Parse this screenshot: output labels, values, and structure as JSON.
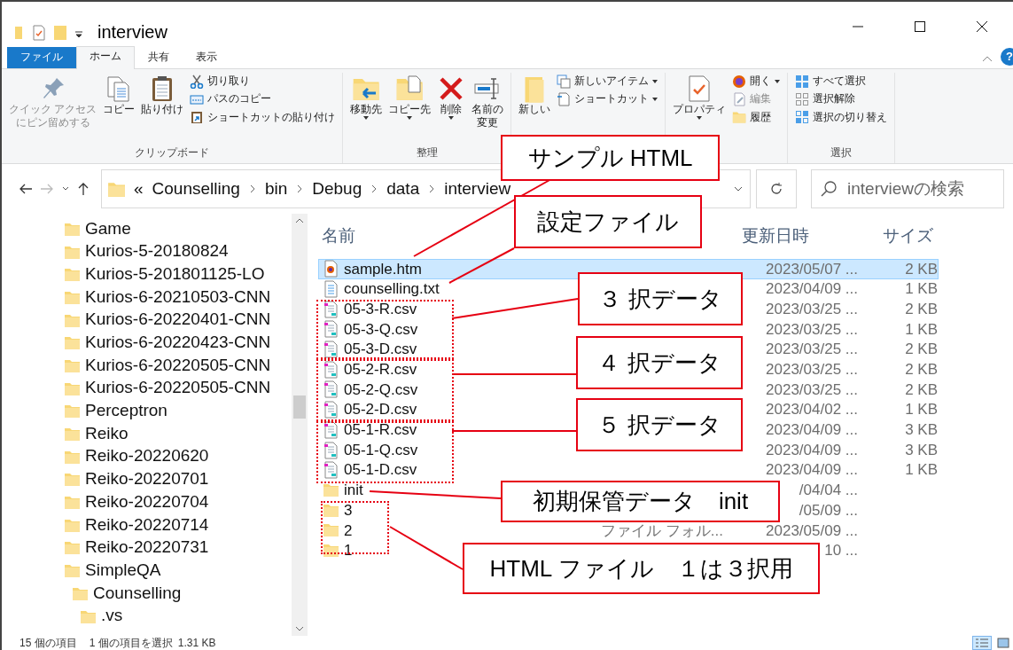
{
  "window": {
    "title": "interview"
  },
  "ribbon_tabs": [
    {
      "label": "ファイル",
      "kind": "file",
      "selected": false
    },
    {
      "label": "ホーム",
      "kind": "tab",
      "selected": true
    },
    {
      "label": "共有",
      "kind": "tab",
      "selected": false
    },
    {
      "label": "表示",
      "kind": "tab",
      "selected": false
    }
  ],
  "help_label": "?",
  "ribbon_groups": [
    {
      "label": "クリップボード",
      "items": [
        {
          "label_lines": [
            "クイック アクセス",
            "にピン留めする"
          ],
          "kind": "large",
          "disabled": true,
          "dropdown": false
        },
        {
          "label": "コピー",
          "kind": "large",
          "disabled": false,
          "dropdown": false
        },
        {
          "label": "貼り付け",
          "kind": "large",
          "disabled": false,
          "dropdown": false
        },
        {
          "label": "切り取り",
          "kind": "small",
          "disabled": false,
          "dropdown": false
        },
        {
          "label": "パスのコピー",
          "kind": "small",
          "disabled": false,
          "dropdown": false
        },
        {
          "label": "ショートカットの貼り付け",
          "kind": "small",
          "disabled": false,
          "dropdown": false
        }
      ]
    },
    {
      "label": "整理",
      "items": [
        {
          "label": "移動先",
          "kind": "large",
          "disabled": false,
          "dropdown": true
        },
        {
          "label": "コピー先",
          "kind": "large",
          "disabled": false,
          "dropdown": true
        },
        {
          "label": "削除",
          "kind": "large",
          "disabled": false,
          "dropdown": true
        },
        {
          "label_lines": [
            "名前の",
            "変更"
          ],
          "kind": "large",
          "disabled": false,
          "dropdown": false
        }
      ]
    },
    {
      "items": [
        {
          "label": "新しい",
          "kind": "large",
          "disabled": false,
          "dropdown": false
        },
        {
          "label": "新しいアイテム",
          "kind": "small",
          "disabled": false,
          "dropdown": true
        },
        {
          "label": "ショートカット",
          "kind": "small",
          "disabled": false,
          "dropdown": true
        }
      ]
    },
    {
      "items": [
        {
          "label": "プロパティ",
          "kind": "large",
          "disabled": false,
          "dropdown": true
        },
        {
          "label": "開く",
          "kind": "small",
          "disabled": false,
          "dropdown": true
        },
        {
          "label": "編集",
          "kind": "small",
          "disabled": true,
          "dropdown": false
        },
        {
          "label": "履歴",
          "kind": "small",
          "disabled": false,
          "dropdown": false
        }
      ]
    },
    {
      "label": "選択",
      "items": [
        {
          "label": "すべて選択",
          "kind": "small",
          "disabled": false,
          "dropdown": false
        },
        {
          "label": "選択解除",
          "kind": "small",
          "disabled": false,
          "dropdown": false
        },
        {
          "label": "選択の切り替え",
          "kind": "small",
          "disabled": false,
          "dropdown": false
        }
      ]
    }
  ],
  "address": {
    "overflow": "«",
    "crumbs": [
      "Counselling",
      "bin",
      "Debug",
      "data",
      "interview"
    ]
  },
  "search": {
    "placeholder": "interviewの検索"
  },
  "nav_tree": [
    {
      "label": "Game"
    },
    {
      "label": "Kurios-5-20180824"
    },
    {
      "label": "Kurios-5-201801125-LO"
    },
    {
      "label": "Kurios-6-20210503-CNN"
    },
    {
      "label": "Kurios-6-20220401-CNN"
    },
    {
      "label": "Kurios-6-20220423-CNN"
    },
    {
      "label": "Kurios-6-20220505-CNN"
    },
    {
      "label": "Kurios-6-20220505-CNN"
    },
    {
      "label": "Perceptron"
    },
    {
      "label": "Reiko"
    },
    {
      "label": "Reiko-20220620"
    },
    {
      "label": "Reiko-20220701"
    },
    {
      "label": "Reiko-20220704"
    },
    {
      "label": "Reiko-20220714"
    },
    {
      "label": "Reiko-20220731"
    },
    {
      "label": "SimpleQA",
      "children": [
        {
          "label": "Counselling",
          "children": [
            {
              "label": ".vs"
            }
          ]
        }
      ]
    }
  ],
  "columns": [
    {
      "label": "名前"
    },
    {
      "label": "更新日時"
    },
    {
      "label": "サイズ"
    }
  ],
  "files": [
    {
      "name": "sample.htm",
      "kind": "html",
      "date": "2023/05/07 ...",
      "size": "2 KB",
      "selected": true
    },
    {
      "name": "counselling.txt",
      "kind": "text",
      "date": "2023/04/09 ...",
      "size": "1 KB",
      "selected": false
    },
    {
      "name": "05-3-R.csv",
      "kind": "csv",
      "date": "2023/03/25 ...",
      "size": "2 KB",
      "selected": false
    },
    {
      "name": "05-3-Q.csv",
      "kind": "csv",
      "date": "2023/03/25 ...",
      "size": "1 KB",
      "selected": false
    },
    {
      "name": "05-3-D.csv",
      "kind": "csv",
      "date": "2023/03/25 ...",
      "size": "2 KB",
      "selected": false
    },
    {
      "name": "05-2-R.csv",
      "kind": "csv",
      "date": "2023/03/25 ...",
      "size": "2 KB",
      "selected": false
    },
    {
      "name": "05-2-Q.csv",
      "kind": "csv",
      "date": "2023/03/25 ...",
      "size": "2 KB",
      "selected": false
    },
    {
      "name": "05-2-D.csv",
      "kind": "csv",
      "date": "2023/04/02 ...",
      "size": "1 KB",
      "selected": false
    },
    {
      "name": "05-1-R.csv",
      "kind": "csv",
      "date": "2023/04/09 ...",
      "size": "3 KB",
      "selected": false
    },
    {
      "name": "05-1-Q.csv",
      "kind": "csv",
      "date": "2023/04/09 ...",
      "size": "3 KB",
      "selected": false
    },
    {
      "name": "05-1-D.csv",
      "kind": "csv",
      "date": "2023/04/09 ...",
      "size": "1 KB",
      "selected": false
    },
    {
      "name": "init",
      "kind": "folder",
      "date": "/04/04 ...",
      "selected": false
    },
    {
      "name": "3",
      "kind": "folder",
      "date": "/05/09 ...",
      "selected": false
    },
    {
      "name": "2",
      "kind": "folder",
      "type": "ファイル フォル...",
      "date": "2023/05/09 ...",
      "selected": false
    },
    {
      "name": "1",
      "kind": "folder",
      "date": "10 ...",
      "selected": false
    }
  ],
  "status_bar": {
    "item_count": "15 個の項目",
    "selection": "1 個の項目を選択",
    "selection_size": "1.31 KB"
  },
  "view_buttons": [
    {
      "selected": true
    },
    {
      "selected": false
    }
  ],
  "annotations": [
    {
      "text": "サンプル HTML"
    },
    {
      "text": "設定ファイル"
    },
    {
      "text": "３ 択データ",
      "outline": true
    },
    {
      "text": "４ 択データ",
      "outline": true
    },
    {
      "text": "５ 択データ",
      "outline": true
    },
    {
      "text": "初期保管データ　init"
    },
    {
      "text": "HTML ファイル　１は３択用",
      "outline": true
    }
  ]
}
